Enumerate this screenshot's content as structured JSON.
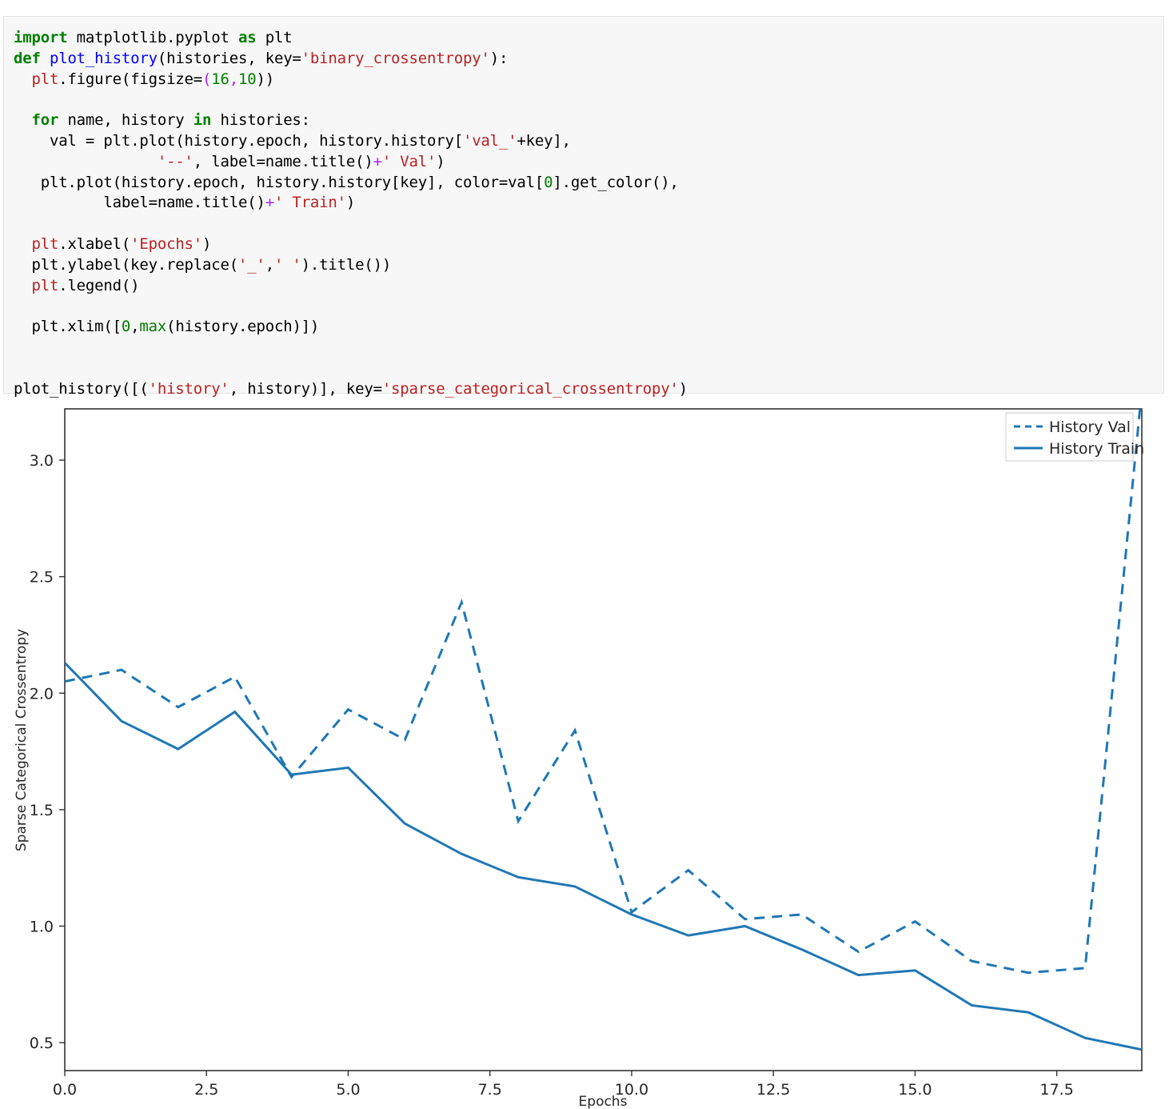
{
  "code_cell": {
    "language": "python",
    "lines": [
      [
        {
          "t": "import",
          "c": "kw"
        },
        {
          "t": " matplotlib.pyplot ",
          "c": ""
        },
        {
          "t": "as",
          "c": "kw"
        },
        {
          "t": " plt",
          "c": ""
        }
      ],
      [
        {
          "t": "def",
          "c": "kw"
        },
        {
          "t": " ",
          "c": ""
        },
        {
          "t": "plot_history",
          "c": "fn"
        },
        {
          "t": "(histories, key=",
          "c": ""
        },
        {
          "t": "'binary_crossentropy'",
          "c": "str"
        },
        {
          "t": "):",
          "c": ""
        }
      ],
      [
        {
          "t": "  ",
          "c": ""
        },
        {
          "t": "plt",
          "c": "pltn"
        },
        {
          "t": ".figure(figsize=",
          "c": ""
        },
        {
          "t": "(",
          "c": "op"
        },
        {
          "t": "16",
          "c": "num"
        },
        {
          "t": ",",
          "c": "op"
        },
        {
          "t": "10",
          "c": "num"
        },
        {
          "t": "))",
          "c": ""
        }
      ],
      [
        {
          "t": "",
          "c": ""
        }
      ],
      [
        {
          "t": "  ",
          "c": ""
        },
        {
          "t": "for",
          "c": "kw"
        },
        {
          "t": " name, history ",
          "c": ""
        },
        {
          "t": "in",
          "c": "kw"
        },
        {
          "t": " histories:",
          "c": ""
        }
      ],
      [
        {
          "t": "    val = plt.plot(history.epoch, history.history[",
          "c": ""
        },
        {
          "t": "'val_'",
          "c": "str"
        },
        {
          "t": "+key],",
          "c": ""
        }
      ],
      [
        {
          "t": "                ",
          "c": ""
        },
        {
          "t": "'--'",
          "c": "str"
        },
        {
          "t": ", label=name.title()",
          "c": ""
        },
        {
          "t": "+",
          "c": "op"
        },
        {
          "t": "' Val'",
          "c": "str"
        },
        {
          "t": ")",
          "c": ""
        }
      ],
      [
        {
          "t": "   plt.plot(history.epoch, history.history[key], color=val[",
          "c": ""
        },
        {
          "t": "0",
          "c": "num"
        },
        {
          "t": "].get_color(),",
          "c": ""
        }
      ],
      [
        {
          "t": "          label=name.title()",
          "c": ""
        },
        {
          "t": "+",
          "c": "op"
        },
        {
          "t": "' Train'",
          "c": "str"
        },
        {
          "t": ")",
          "c": ""
        }
      ],
      [
        {
          "t": "",
          "c": ""
        }
      ],
      [
        {
          "t": "  ",
          "c": ""
        },
        {
          "t": "plt",
          "c": "pltn"
        },
        {
          "t": ".xlabel(",
          "c": ""
        },
        {
          "t": "'Epochs'",
          "c": "str"
        },
        {
          "t": ")",
          "c": ""
        }
      ],
      [
        {
          "t": "  plt.ylabel(key.replace(",
          "c": ""
        },
        {
          "t": "'_'",
          "c": "str"
        },
        {
          "t": ",",
          "c": ""
        },
        {
          "t": "' '",
          "c": "str"
        },
        {
          "t": ").title())",
          "c": ""
        }
      ],
      [
        {
          "t": "  ",
          "c": ""
        },
        {
          "t": "plt",
          "c": "pltn"
        },
        {
          "t": ".legend()",
          "c": ""
        }
      ],
      [
        {
          "t": "",
          "c": ""
        }
      ],
      [
        {
          "t": "  plt.xlim([",
          "c": ""
        },
        {
          "t": "0",
          "c": "num"
        },
        {
          "t": ",",
          "c": ""
        },
        {
          "t": "max",
          "c": "bi"
        },
        {
          "t": "(history.epoch)])",
          "c": ""
        }
      ],
      [
        {
          "t": "",
          "c": ""
        }
      ],
      [
        {
          "t": "",
          "c": ""
        }
      ],
      [
        {
          "t": "plot_history([(",
          "c": ""
        },
        {
          "t": "'history'",
          "c": "str"
        },
        {
          "t": ", history)], key=",
          "c": ""
        },
        {
          "t": "'sparse_categorical_crossentropy'",
          "c": "str"
        },
        {
          "t": ")",
          "c": ""
        }
      ]
    ],
    "plain_text": "import matplotlib.pyplot as plt\ndef plot_history(histories, key='binary_crossentropy'):\n  plt.figure(figsize=(16,10))\n\n  for name, history in histories:\n    val = plt.plot(history.epoch, history.history['val_'+key],\n                '--', label=name.title()+' Val')\n   plt.plot(history.epoch, history.history[key], color=val[0].get_color(),\n          label=name.title()+' Train')\n\n  plt.xlabel('Epochs')\n  plt.ylabel(key.replace('_',' ').title())\n  plt.legend()\n\n  plt.xlim([0,max(history.epoch)])\n\n\nplot_history([('history', history)], key='sparse_categorical_crossentropy')"
  },
  "chart_data": {
    "type": "line",
    "title": "",
    "xlabel": "Epochs",
    "ylabel": "Sparse Categorical Crossentropy",
    "x": [
      0,
      1,
      2,
      3,
      4,
      5,
      6,
      7,
      8,
      9,
      10,
      11,
      12,
      13,
      14,
      15,
      16,
      17,
      18,
      19
    ],
    "series": [
      {
        "name": "History Val",
        "style": "dashed",
        "color": "#1f77b4",
        "values": [
          2.05,
          2.1,
          1.94,
          2.07,
          1.64,
          1.93,
          1.8,
          2.39,
          1.45,
          1.84,
          1.06,
          1.24,
          1.03,
          1.05,
          0.89,
          1.02,
          0.85,
          0.8,
          0.82,
          3.3
        ]
      },
      {
        "name": "History Train",
        "style": "solid",
        "color": "#1f77b4",
        "values": [
          2.13,
          1.88,
          1.76,
          1.92,
          1.65,
          1.68,
          1.44,
          1.31,
          1.21,
          1.17,
          1.05,
          0.96,
          1.0,
          0.9,
          0.79,
          0.81,
          0.66,
          0.63,
          0.52,
          0.47
        ]
      }
    ],
    "xlim": [
      0,
      19
    ],
    "ylim": [
      0.38,
      3.22
    ],
    "xticks": [
      0.0,
      2.5,
      5.0,
      7.5,
      10.0,
      12.5,
      15.0,
      17.5
    ],
    "xticklabels": [
      "0.0",
      "2.5",
      "5.0",
      "7.5",
      "10.0",
      "12.5",
      "15.0",
      "17.5"
    ],
    "yticks": [
      0.5,
      1.0,
      1.5,
      2.0,
      2.5,
      3.0
    ],
    "yticklabels": [
      "0.5",
      "1.0",
      "1.5",
      "2.0",
      "2.5",
      "3.0"
    ],
    "grid": false,
    "legend_position": "upper right",
    "legend_entries": [
      "History Val",
      "History Train"
    ],
    "frame": true
  }
}
